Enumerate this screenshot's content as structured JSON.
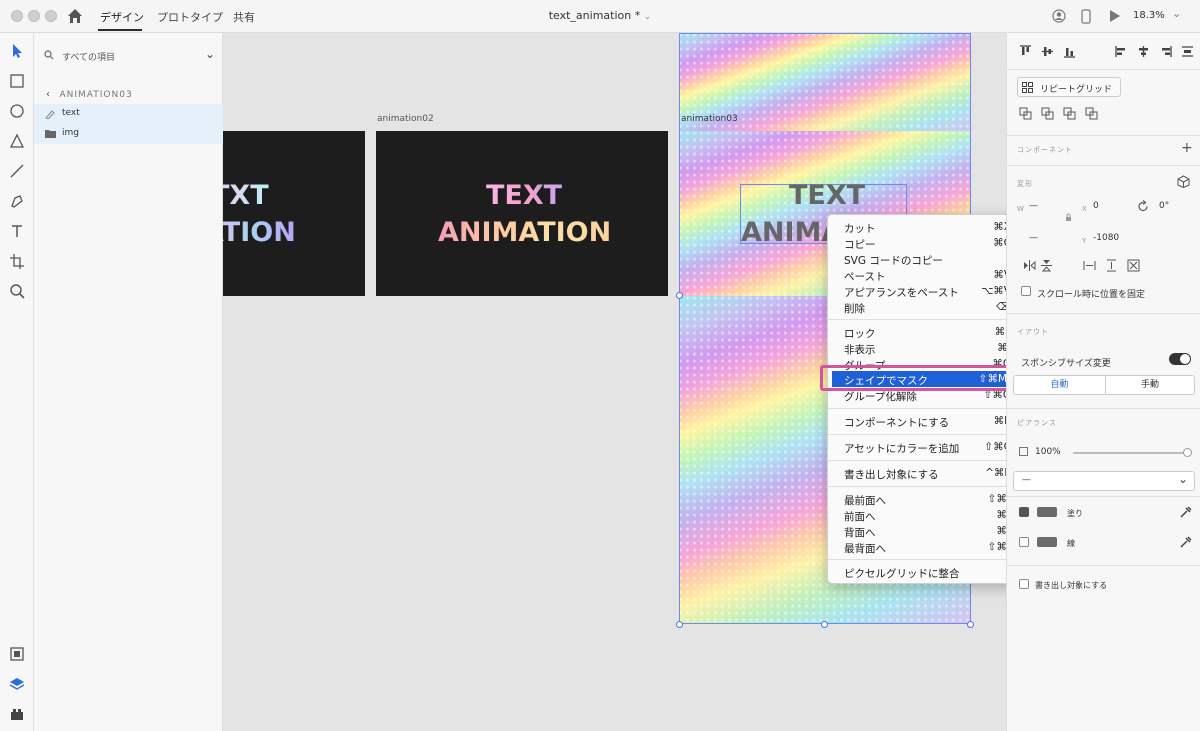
{
  "app": {
    "tabs": [
      "デザイン",
      "プロトタイプ",
      "共有"
    ],
    "doc_title": "text_animation *",
    "zoom": "18.3%"
  },
  "layers": {
    "search_placeholder": "すべての項目",
    "breadcrumb": "ANIMATION03",
    "items": [
      "text",
      "img"
    ]
  },
  "canvas": {
    "artboards": [
      {
        "label": "animation02",
        "lines": [
          "TEXT",
          "ANIMATION"
        ]
      },
      {
        "label": "animation03",
        "lines": [
          "TEXT",
          "ANIMA"
        ]
      }
    ],
    "partial_artboard_lines": [
      "TXT",
      "ATION"
    ]
  },
  "context_menu": {
    "groups": [
      [
        {
          "label": "カット",
          "shortcut": "⌘X"
        },
        {
          "label": "コピー",
          "shortcut": "⌘C"
        },
        {
          "label": "SVG コードのコピー",
          "shortcut": ""
        },
        {
          "label": "ペースト",
          "shortcut": "⌘V"
        },
        {
          "label": "アピアランスをペースト",
          "shortcut": "⌥⌘V"
        },
        {
          "label": "削除",
          "shortcut": "⌫"
        }
      ],
      [
        {
          "label": "ロック",
          "shortcut": "⌘L"
        },
        {
          "label": "非表示",
          "shortcut": "⌘,"
        },
        {
          "label": "グループ",
          "shortcut": "⌘G"
        },
        {
          "label": "シェイプでマスク",
          "shortcut": "⇧⌘M",
          "highlighted": true
        },
        {
          "label": "グループ化解除",
          "shortcut": "⇧⌘G"
        }
      ],
      [
        {
          "label": "コンポーネントにする",
          "shortcut": "⌘K"
        }
      ],
      [
        {
          "label": "アセットにカラーを追加",
          "shortcut": "⇧⌘C"
        }
      ],
      [
        {
          "label": "書き出し対象にする",
          "shortcut": "^⌘E"
        }
      ],
      [
        {
          "label": "最前面へ",
          "shortcut": "⇧⌘]"
        },
        {
          "label": "前面へ",
          "shortcut": "⌘]"
        },
        {
          "label": "背面へ",
          "shortcut": "⌘["
        },
        {
          "label": "最背面へ",
          "shortcut": "⇧⌘["
        }
      ],
      [
        {
          "label": "ピクセルグリッドに整合",
          "shortcut": ""
        }
      ]
    ]
  },
  "inspector": {
    "repeat_grid": "リピートグリッド",
    "component_title": "コンポーネント",
    "transform_title": "変形",
    "w_label": "W",
    "w_value": "—",
    "x_label": "X",
    "x_value": "0",
    "rotation": "0°",
    "h_value": "—",
    "y_label": "Y",
    "y_value": "-1080",
    "fix_on_scroll": "スクロール時に位置を固定",
    "layout_title": "イアウト",
    "responsive": "スポンシブサイズ変更",
    "auto": "自動",
    "manual": "手動",
    "appearance_title": "ピアランス",
    "opacity": "100%",
    "blend": "—",
    "fill_label": "塗り",
    "stroke_label": "線",
    "export_label": "書き出し対象にする"
  }
}
